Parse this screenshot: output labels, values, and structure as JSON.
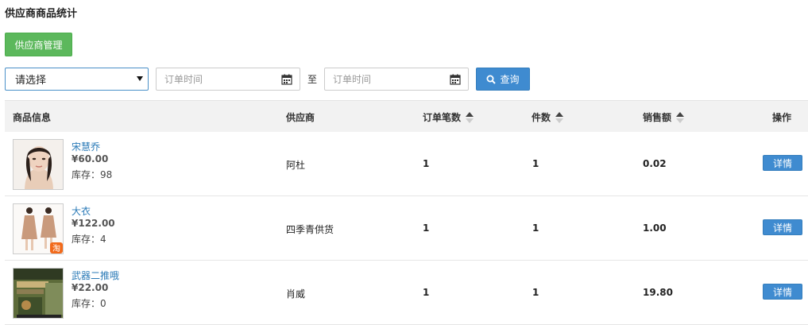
{
  "page": {
    "title": "供应商商品统计"
  },
  "toolbar": {
    "manage_label": "供应商管理"
  },
  "filters": {
    "select_value": "请选择",
    "date_from_placeholder": "订单时间",
    "to_label": "至",
    "date_to_placeholder": "订单时间",
    "search_label": "查询"
  },
  "table": {
    "headers": {
      "product": "商品信息",
      "supplier": "供应商",
      "orders": "订单笔数",
      "quantity": "件数",
      "sales": "销售额",
      "actions": "操作"
    },
    "rows": [
      {
        "name": "宋慧乔",
        "price": "¥60.00",
        "stock": "库存：98",
        "supplier": "阿杜",
        "orders": "1",
        "quantity": "1",
        "sales": "0.02",
        "action": "详情"
      },
      {
        "name": "大衣",
        "price": "¥122.00",
        "stock": "库存：4",
        "supplier": "四季青供货",
        "orders": "1",
        "quantity": "1",
        "sales": "1.00",
        "action": "详情"
      },
      {
        "name": "武器二推哦",
        "price": "¥22.00",
        "stock": "库存：0",
        "supplier": "肖威",
        "orders": "1",
        "quantity": "1",
        "sales": "19.80",
        "action": "详情"
      }
    ]
  },
  "colors": {
    "manage_button": "#5cb85c",
    "primary": "#3f8bd0",
    "link": "#2a7ab7",
    "header_bg": "#f2f2f2"
  },
  "icons": {
    "search": "search-icon",
    "calendar": "calendar-icon",
    "sort": "sort-icon",
    "dropdown": "chevron-down-icon"
  }
}
